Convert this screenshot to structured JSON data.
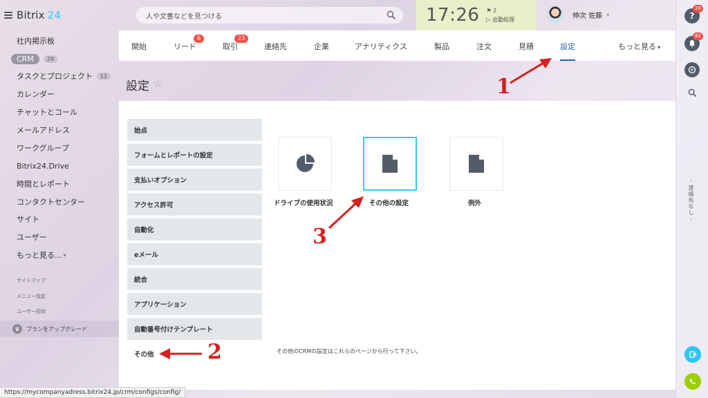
{
  "app": {
    "logo_name": "Bitrix",
    "logo_num": "24"
  },
  "sidebar": {
    "items": [
      {
        "label": "社内掲示板"
      },
      {
        "label": "CRM",
        "count": "29"
      },
      {
        "label": "タスクとプロジェクト",
        "count": "11"
      },
      {
        "label": "カレンダー"
      },
      {
        "label": "チャットとコール"
      },
      {
        "label": "メールアドレス"
      },
      {
        "label": "ワークグループ"
      },
      {
        "label": "Bitrix24.Drive"
      },
      {
        "label": "時間とレポート"
      },
      {
        "label": "コンタクトセンター"
      },
      {
        "label": "サイト"
      },
      {
        "label": "ユーザー"
      },
      {
        "label": "もっと見る..."
      }
    ],
    "small_links": [
      "サイトマップ",
      "メニュー設定",
      "ユーザー招待"
    ],
    "upgrade_label": "プランをアップグレード"
  },
  "status_url": "https://mycompanyadress.bitrix24.jp/crm/configs/config/",
  "search": {
    "placeholder": "人や文書などを見つける"
  },
  "clock": {
    "time": "17:26",
    "flag_count": "2",
    "status": "出勤処理"
  },
  "user": {
    "name": "伸次 佐藤"
  },
  "rail": {
    "help_badge": "20",
    "bell_badge": "62",
    "vertical_text": "- 連絡先なし -"
  },
  "tabs": [
    {
      "label": "開始"
    },
    {
      "label": "リード",
      "badge": "6"
    },
    {
      "label": "取引",
      "badge": "23"
    },
    {
      "label": "連絡先"
    },
    {
      "label": "企業"
    },
    {
      "label": "アナリティクス"
    },
    {
      "label": "製品"
    },
    {
      "label": "注文"
    },
    {
      "label": "見積"
    },
    {
      "label": "設定",
      "active": true
    },
    {
      "label": "もっと見る"
    }
  ],
  "page_title": "設定",
  "settings_menu": [
    "始点",
    "フォームとレポートの設定",
    "支払いオプション",
    "アクセス許可",
    "自動化",
    "eメール",
    "統合",
    "アプリケーション",
    "自動番号付けテンプレート",
    "その他"
  ],
  "tiles": [
    {
      "label": "ドライブの使用状況",
      "icon": "pie-chart-icon"
    },
    {
      "label": "その他の設定",
      "icon": "document-icon",
      "selected": true
    },
    {
      "label": "例外",
      "icon": "document-icon"
    }
  ],
  "panel_note": "その他のCRMの設定はこれらのページから行って下さい。",
  "annotations": [
    "1",
    "2",
    "3"
  ],
  "colors": {
    "accent": "#2fc6f6",
    "active_tab": "#2066b0",
    "badge": "#f2514a",
    "arrow": "#d42020",
    "selected_tile": "#3bc8eb"
  }
}
